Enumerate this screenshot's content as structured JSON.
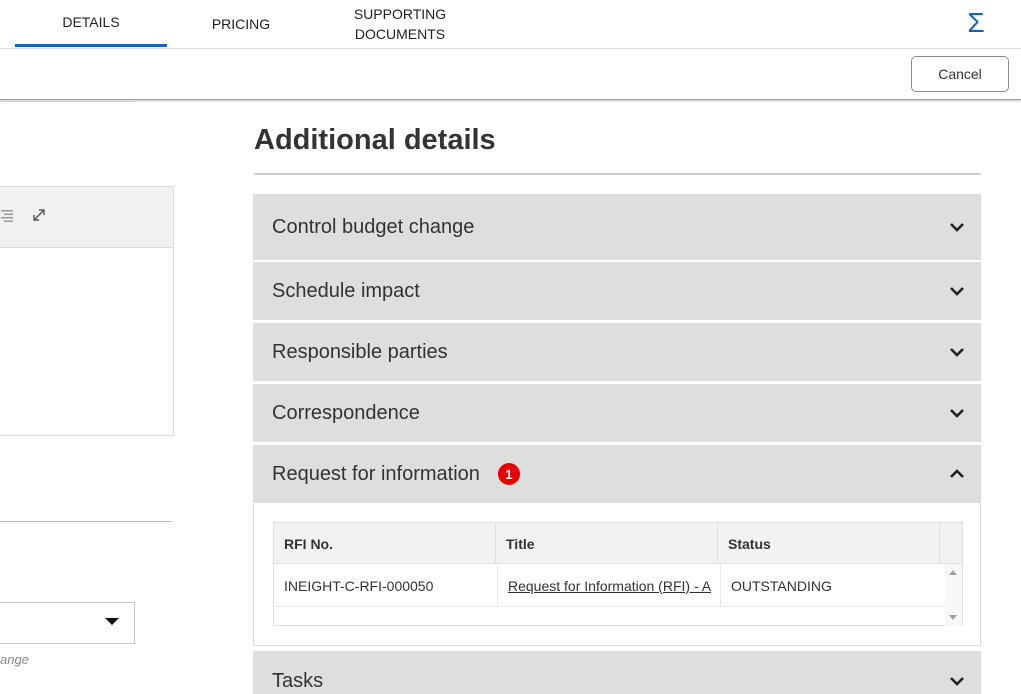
{
  "tabs": [
    {
      "label": "DETAILS",
      "active": true
    },
    {
      "label": "PRICING",
      "active": false
    },
    {
      "label": "SUPPORTING\nDOCUMENTS",
      "active": false
    }
  ],
  "toolbar": {
    "sigma_icon": "Σ",
    "cancel_label": "Cancel"
  },
  "left_panel": {
    "hint_text": "ange"
  },
  "additional_details": {
    "title": "Additional details",
    "sections": [
      {
        "label": "Control budget change",
        "expanded": false
      },
      {
        "label": "Schedule impact",
        "expanded": false
      },
      {
        "label": "Responsible parties",
        "expanded": false
      },
      {
        "label": "Correspondence",
        "expanded": false
      },
      {
        "label": "Request for information",
        "expanded": true,
        "badge": "1"
      },
      {
        "label": "Tasks",
        "expanded": false
      }
    ],
    "rfi_table": {
      "columns": [
        "RFI No.",
        "Title",
        "Status"
      ],
      "rows": [
        {
          "rfi_no": "INEIGHT-C-RFI-000050",
          "title": "Request for Information (RFI) - A",
          "status": "OUTSTANDING"
        }
      ]
    }
  },
  "colors": {
    "accent": "#1565c0",
    "badge": "#e60000",
    "accordion_bg": "#dedede"
  },
  "icons": [
    "sigma-icon",
    "align-icon",
    "expand-icon",
    "chevron-down-icon",
    "chevron-up-icon",
    "dropdown-caret-icon"
  ]
}
